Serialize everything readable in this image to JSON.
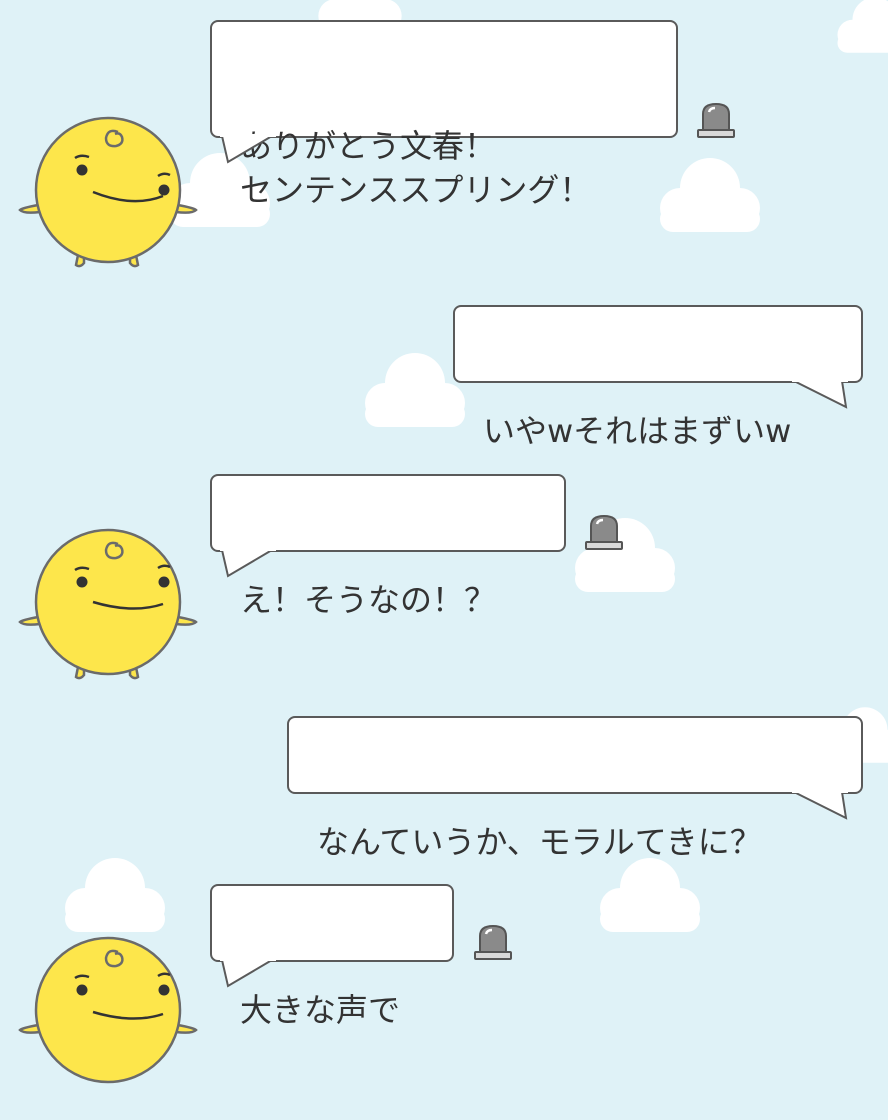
{
  "colors": {
    "background": "#dff2f7",
    "cloud": "#ffffff",
    "bubble_fill": "#ffffff",
    "bubble_border": "#5a5a5a",
    "text": "#333333",
    "avatar_yellow": "#fde64b",
    "avatar_outline": "#6b6b6b",
    "report_icon": "#8a8a8a"
  },
  "messages": [
    {
      "sender": "bot",
      "text": "ありがとう文春！\nセンテンススプリング！",
      "icon": "report-icon"
    },
    {
      "sender": "user",
      "text": "いやwそれはまずいw"
    },
    {
      "sender": "bot",
      "text": "え！そうなの！？",
      "icon": "report-icon"
    },
    {
      "sender": "user",
      "text": "なんていうか、モラルてきに？"
    },
    {
      "sender": "bot",
      "text": "大きな声で",
      "icon": "report-icon"
    }
  ]
}
